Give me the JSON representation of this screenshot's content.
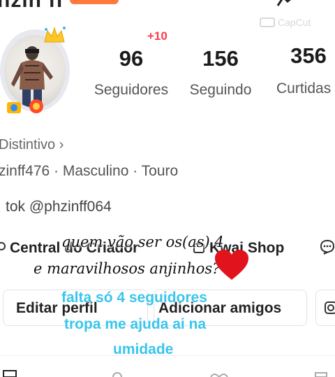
{
  "profile": {
    "name_partial": "nzin ff",
    "distintivo": "Distintivo",
    "meta": "zinff476 · Masculino · Touro",
    "tiktok": "tok @phzinff064"
  },
  "stats": {
    "new_badge": "+10",
    "followers_count": "96",
    "followers_label": "Seguidores",
    "following_count": "156",
    "following_label": "Seguindo",
    "likes_count": "356",
    "likes_label": "Curtidas"
  },
  "actions": {
    "creator_center": "Central do Criador",
    "kwai_shop": "Kwai Shop",
    "edit_profile": "Editar perfil",
    "add_friends": "Adicionar amigos"
  },
  "overlay": {
    "line1": "quem vão ser os(as) 4",
    "line2": "e maravilhosos anjinhos?",
    "heart": "❤️",
    "cyan1": "falta só 4 seguidores",
    "cyan2": "tropa me ajuda ai na",
    "cyan3": "umidade"
  },
  "watermark": "CapCut",
  "colors": {
    "accent_red": "#ff3b4a",
    "caption_cyan": "#39c5ec",
    "badge_orange": "#ff7a3d"
  }
}
